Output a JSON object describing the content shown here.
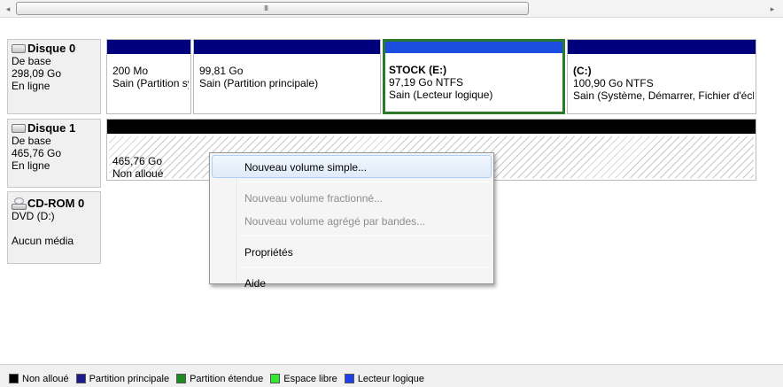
{
  "scrollbar": {
    "left_arrow": "◂",
    "right_arrow": "▸",
    "grip": "III"
  },
  "disks": [
    {
      "name": "Disque 0",
      "type": "De base",
      "size": "298,09 Go",
      "status": "En ligne",
      "partitions": [
        {
          "title": "",
          "line1": "200 Mo",
          "line2": "Sain (Partition système)",
          "kind": "primary"
        },
        {
          "title": "",
          "line1": "99,81 Go",
          "line2": "Sain (Partition principale)",
          "kind": "primary"
        },
        {
          "title": "STOCK (E:)",
          "line1": "97,19 Go NTFS",
          "line2": "Sain (Lecteur logique)",
          "kind": "logical"
        },
        {
          "title": "(C:)",
          "line1": "100,90 Go NTFS",
          "line2": "Sain (Système, Démarrer, Fichier d'échange, Partition active)",
          "kind": "primary"
        }
      ]
    },
    {
      "name": "Disque 1",
      "type": "De base",
      "size": "465,76 Go",
      "status": "En ligne",
      "partitions": [
        {
          "title": "",
          "line1": "465,76 Go",
          "line2": "Non alloué",
          "kind": "unallocated"
        }
      ]
    },
    {
      "name": "CD-ROM 0",
      "type": "DVD (D:)",
      "size": "",
      "status": "Aucun média"
    }
  ],
  "context_menu": {
    "items": [
      {
        "label": "Nouveau volume simple...",
        "enabled": true,
        "highlighted": true
      },
      {
        "label": "Nouveau volume fractionné...",
        "enabled": false
      },
      {
        "label": "Nouveau volume agrégé par bandes...",
        "enabled": false
      },
      {
        "label": "Propriétés",
        "enabled": true
      },
      {
        "label": "Aide",
        "enabled": true
      }
    ]
  },
  "legend": [
    {
      "label": "Non alloué",
      "color": "#000000"
    },
    {
      "label": "Partition principale",
      "color": "#1a1a8c"
    },
    {
      "label": "Partition étendue",
      "color": "#1f8a1f"
    },
    {
      "label": "Espace libre",
      "color": "#33e833"
    },
    {
      "label": "Lecteur logique",
      "color": "#1f3fe6"
    }
  ],
  "colors": {
    "primary_bar": "#00007c",
    "logical_bar": "#1a4de0",
    "unallocated_bar": "#000000",
    "selection_border": "#2b7a2b"
  }
}
